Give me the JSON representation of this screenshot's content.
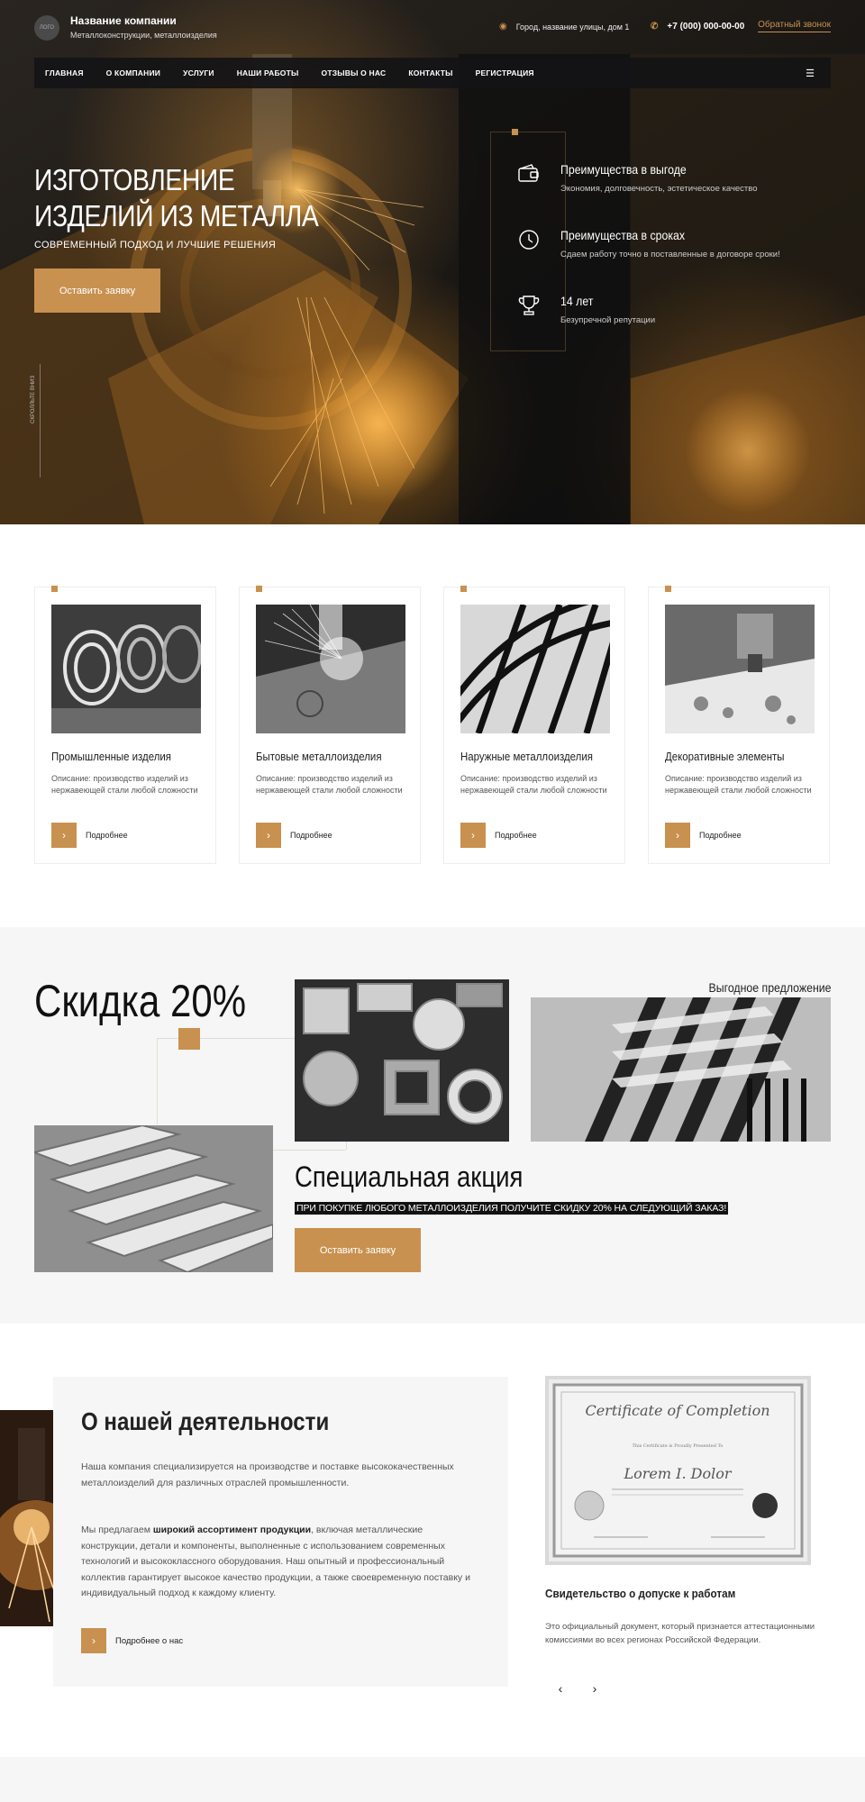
{
  "header": {
    "logo": "ЛОГО",
    "company_name": "Название компании",
    "company_sub": "Металлоконструкции, металлоизделия",
    "address": "Город, название улицы, дом 1",
    "phone": "+7 (000) 000-00-00",
    "callback": "Обратный звонок"
  },
  "nav": {
    "items": [
      {
        "label": "ГЛАВНАЯ"
      },
      {
        "label": "О КОМПАНИИ"
      },
      {
        "label": "УСЛУГИ"
      },
      {
        "label": "НАШИ РАБОТЫ"
      },
      {
        "label": "ОТЗЫВЫ О НАС"
      },
      {
        "label": "КОНТАКТЫ"
      },
      {
        "label": "РЕГИСТРАЦИЯ"
      }
    ]
  },
  "hero": {
    "title_line1": "ИЗГОТОВЛЕНИЕ",
    "title_line2": "ИЗДЕЛИЙ ИЗ МЕТАЛЛА",
    "subtitle": "СОВРЕМЕННЫЙ ПОДХОД И ЛУЧШИЕ РЕШЕНИЯ",
    "button": "Оставить заявку",
    "scroll": "СКРОЛЛЬТЕ ВНИЗ"
  },
  "advantages": [
    {
      "icon": "wallet-icon",
      "title": "Преимущества в выгоде",
      "desc": "Экономия, долговечность, эстетическое качество"
    },
    {
      "icon": "clock-icon",
      "title": "Преимущества в сроках",
      "desc": "Сдаем работу точно в поставленные в договоре сроки!"
    },
    {
      "icon": "trophy-icon",
      "title": "14 лет",
      "desc": "Безупречной репутации"
    }
  ],
  "categories": [
    {
      "title": "Промышленные изделия",
      "desc": "Описание: производство изделий из нержавеющей стали любой сложности",
      "more": "Подробнее"
    },
    {
      "title": "Бытовые металлоизделия",
      "desc": "Описание: производство изделий из нержавеющей стали любой сложности",
      "more": "Подробнее"
    },
    {
      "title": "Наружные металлоизделия",
      "desc": "Описание: производство изделий из нержавеющей стали любой сложности",
      "more": "Подробнее"
    },
    {
      "title": "Декоративные элементы",
      "desc": "Описание: производство изделий из нержавеющей стали любой сложности",
      "more": "Подробнее"
    }
  ],
  "promo": {
    "title": "Скидка 20%",
    "note": "Выгодное предложение",
    "subtitle": "Специальная акция",
    "text": "ПРИ ПОКУПКЕ ЛЮБОГО МЕТАЛЛОИЗДЕЛИЯ ПОЛУЧИТЕ СКИДКУ 20% НА СЛЕДУЮЩИЙ ЗАКАЗ!",
    "button": "Оставить заявку"
  },
  "about": {
    "title": "О нашей деятельности",
    "p1": "Наша компания специализируется на производстве и поставке высококачественных металлоизделий для различных отраслей промышленности.",
    "p2_prefix": "Мы предлагаем ",
    "p2_bold": "широкий ассортимент продукции",
    "p2_rest": ", включая металлические конструкции, детали и компоненты, выполненные с использованием современных технологий и высококлассного оборудования. Наш опытный и профессиональный коллектив гарантирует высокое качество продукции, а также своевременную поставку и индивидуальный подход к каждому клиенту.",
    "more": "Подробнее о нас"
  },
  "certificate": {
    "heading": "Certificate of Completion",
    "caption": "This Certificate is Proudly Presented To",
    "name": "Lorem I. Dolor",
    "title": "Свидетельство о допуске к работам",
    "desc": "Это официальный документ, который признается аттестационными комиссиями во всех регионах Российской Федерации.",
    "prev": "‹",
    "next": "›"
  },
  "colors": {
    "accent": "#c8914f",
    "dark": "#111111",
    "light_bg": "#f6f6f6"
  }
}
